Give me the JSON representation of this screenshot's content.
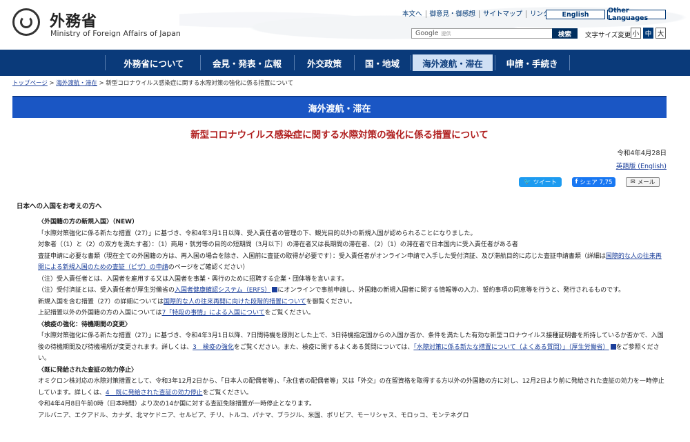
{
  "header": {
    "title_ja": "外務省",
    "title_en": "Ministry of Foreign Affairs of Japan",
    "util_links": [
      "本文へ",
      "御意見・御感想",
      "サイトマップ",
      "リンク集"
    ],
    "english": "English",
    "other_languages": "Other Languages",
    "search_brand": "Google",
    "search_sub": "提供",
    "search_button": "検索",
    "fontsize_label": "文字サイズ変更",
    "fontsize_options": [
      "小",
      "中",
      "大"
    ]
  },
  "nav": {
    "items": [
      "外務省について",
      "会見・発表・広報",
      "外交政策",
      "国・地域",
      "海外渡航・滞在",
      "申請・手続き"
    ],
    "active_index": 4
  },
  "breadcrumb": {
    "home": "トップページ",
    "section": "海外渡航・滞在",
    "sep": " > ",
    "current": "新型コロナウイルス感染症に関する水際対策の強化に係る措置について"
  },
  "section_title": "海外渡航・滞在",
  "page": {
    "title": "新型コロナウイルス感染症に関する水際対策の強化に係る措置について",
    "date": "令和4年4月28日",
    "english_link": "英語版 (English)"
  },
  "share": {
    "tweet": "ツイート",
    "facebook": "シェア 7,75",
    "mail": "メール"
  },
  "intro_heading": "日本への入国をお考えの方へ",
  "content": {
    "h1": "〈外国籍の方の新規入国〉（NEW）",
    "p1": "「水際対策強化に係る新たな措置（27）」に基づき、令和4年3月1日以降、受入責任者の管理の下、観光目的以外の新規入国が認められることになりました。",
    "p2": "対象者（（1）と（2）の双方を満たす者）：（1）商用・就労等の目的の短期間（3月以下）の滞在者又は長期間の滞在者、（2）（1）の滞在者で日本国内に受入責任者がある者",
    "p3_pre": "査証申請に必要な書類（現在全ての外国籍の方は、再入国の場合を除き、入国前に査証の取得が必要です）：受入責任者がオンライン申請で入手した受付済証、及び滞航目的に応じた査証申請書類（詳細は",
    "p3_link": "国際的な人の往来再開による新規入国のための査証（ビザ）の申請",
    "p3_post": "のページをご確認ください）",
    "p4": "（注）受入責任者とは、入国者を雇用する又は入国者を事業・興行のために招聘する企業・団体等を言います。",
    "p5_pre": "（注）受付済証とは、受入責任者が厚生労働省の",
    "p5_link": "入国者健康確認システム（ERFS）",
    "p5_post": "にオンラインで事前申請し、外国籍の新規入国者に関する情報等の入力、誓約事項の同意等を行うと、発行されるものです。",
    "p6_pre": "新規入国を含む措置（27）の詳細については",
    "p6_link": "国際的な人の往来再開に向けた段階的措置について",
    "p6_post": "を御覧ください。",
    "p7_pre": "上記措置以外の外国籍の方の入国については",
    "p7_link": "7「特段の事情」による入国について",
    "p7_post": "をご覧ください。",
    "h2": "〈検疫の強化：待機期間の変更〉",
    "p8_pre": "「水際対策強化に係る新たな措置（27）」に基づき、令和4年3月1日以降、7日間待機を原則とした上で、3日待機指定国からの入国か否か、条件を満たした有効な新型コロナウイルス接種証明書を所持しているか否かで、入国後の待機期間及び待機場所が変更されます。詳しくは、",
    "p8_link1": "3　検疫の強化",
    "p8_mid": "をご覧ください。また、検疫に関するよくある質問については、",
    "p8_link2": "「水際対策に係る新たな措置について（よくある質問）」（厚生労働省）",
    "p8_post": "をご参照ください。",
    "h3": "〈既に発給された査証の効力停止〉",
    "p9_pre": "オミクロン株対応の水際対策措置として、令和3年12月2日から、「日本人の配偶者等」、「永住者の配偶者等」又は「外交」の在留資格を取得する方以外の外国籍の方に対し、12月2日より前に発給された査証の効力を一時停止しています。詳しくは、",
    "p9_link": "4　既に発給された査証の効力停止",
    "p9_post": "をご覧ください。",
    "p10": "令和4年4月8日午前0時（日本時間）より次の14か国に対する査証免除措置が一時停止となります。",
    "p11": "アルバニア、エクアドル、カナダ、北マケドニア、セルビア、チリ、トルコ、パナマ、ブラジル、米国、ボリビア、モーリシャス、モロッコ、モンテネグロ"
  }
}
